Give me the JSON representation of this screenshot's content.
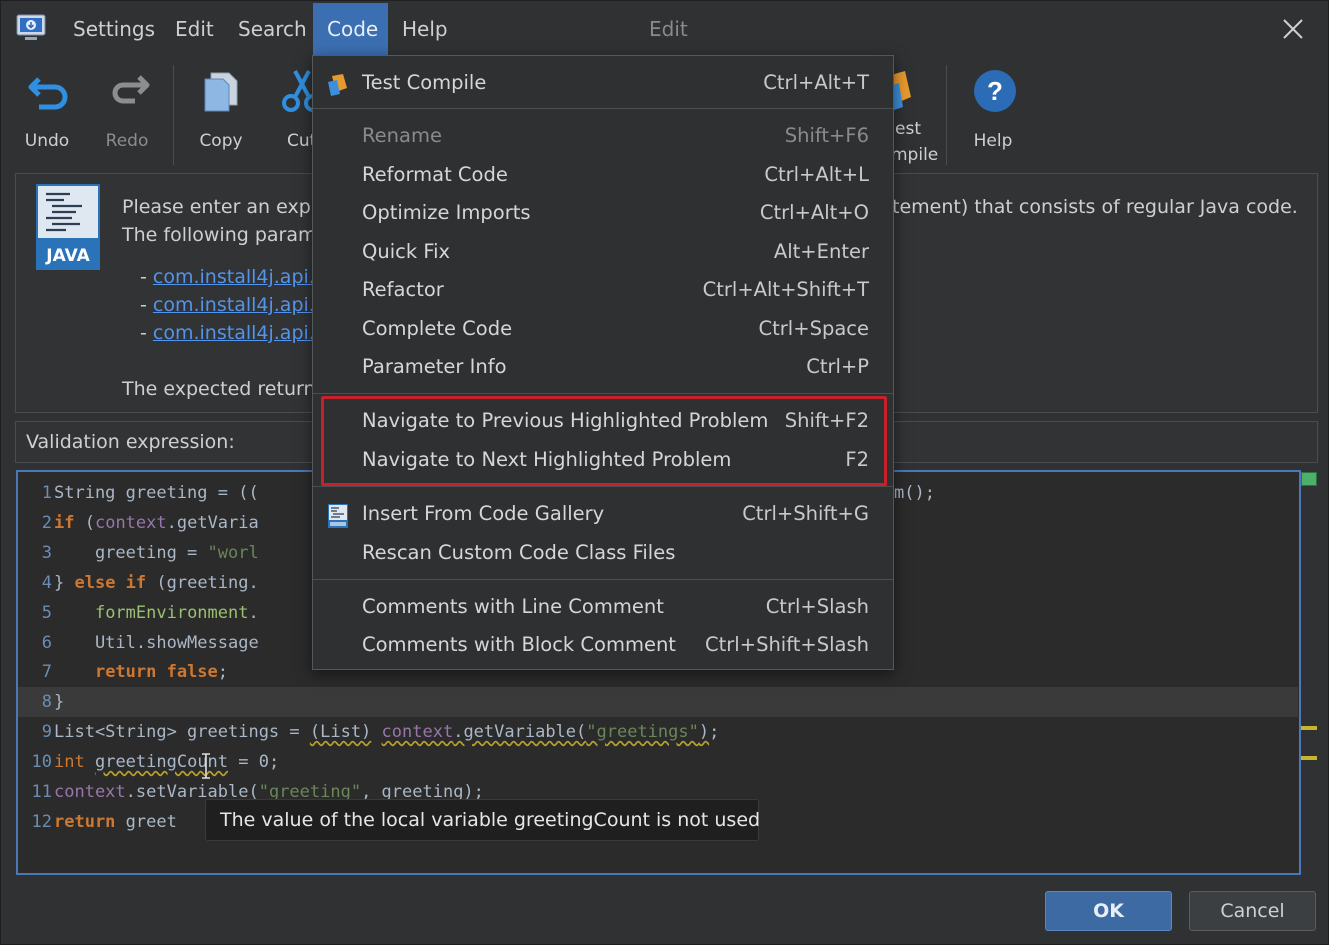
{
  "menubar": {
    "items": [
      "Settings",
      "Edit",
      "Search",
      "Code",
      "Help"
    ],
    "active": "Code",
    "window_title": "Edit"
  },
  "toolbar": {
    "undo": "Undo",
    "redo": "Redo",
    "copy": "Copy",
    "cut_partial": "Cut",
    "test_compile_partial_1": "est",
    "test_compile_partial_2": "mpile",
    "help": "Help"
  },
  "info": {
    "logo_text": "JAVA",
    "line1_left": "Please enter an expr",
    "line1_right": "tement) that consists of regular Java code.",
    "line2_left": "The following param",
    "links": [
      "com.install4j.api.c",
      "com.install4j.api.s",
      "com.install4j.api.f"
    ],
    "link_prefix": "- ",
    "line_return": "The expected return"
  },
  "validation_label": "Validation expression:",
  "editor": {
    "lines": [
      {
        "n": "1",
        "segments": [
          [
            "pl",
            "String greeting = (("
          ]
        ],
        "tail": "m();"
      },
      {
        "n": "2",
        "segments": [
          [
            "kw",
            "if"
          ],
          [
            "pl",
            " ("
          ],
          [
            "fld",
            "context"
          ],
          [
            "pl",
            ".getVaria"
          ]
        ]
      },
      {
        "n": "3",
        "segments": [
          [
            "pl",
            "    greeting = "
          ],
          [
            "str",
            "\"worl"
          ]
        ]
      },
      {
        "n": "4",
        "segments": [
          [
            "pl",
            "} "
          ],
          [
            "kw",
            "else if"
          ],
          [
            "pl",
            " (greeting."
          ]
        ]
      },
      {
        "n": "5",
        "segments": [
          [
            "pl",
            "    "
          ],
          [
            "grn",
            "formEnvironment"
          ],
          [
            "pl",
            "."
          ]
        ]
      },
      {
        "n": "6",
        "segments": [
          [
            "pl",
            "    Util.showMessage"
          ]
        ]
      },
      {
        "n": "7",
        "segments": [
          [
            "pl",
            "    "
          ],
          [
            "kw",
            "return false"
          ],
          [
            "pl",
            ";"
          ]
        ]
      },
      {
        "n": "8",
        "segments": [
          [
            "pl",
            "}"
          ]
        ]
      },
      {
        "n": "9",
        "segments": [
          [
            "pl",
            "List<String> greetings = "
          ],
          [
            "uwp",
            "(List)"
          ],
          [
            "pl",
            " "
          ],
          [
            "uwf",
            "context"
          ],
          [
            "uwp",
            ".getVariable("
          ],
          [
            "uws",
            "\"greetings\""
          ],
          [
            "uwp",
            ")"
          ],
          [
            "pl",
            ";"
          ]
        ]
      },
      {
        "n": "10",
        "segments": [
          [
            "kw2",
            "int"
          ],
          [
            "pl",
            " "
          ],
          [
            "uwp",
            "greetingCount"
          ],
          [
            "pl",
            " = 0;"
          ]
        ]
      },
      {
        "n": "11",
        "segments": [
          [
            "fld",
            "context"
          ],
          [
            "pl",
            ".setVariable("
          ],
          [
            "str",
            "\"greeting\""
          ],
          [
            "pl",
            ", greeting);"
          ]
        ]
      },
      {
        "n": "12",
        "segments": [
          [
            "kw",
            "return"
          ],
          [
            "pl",
            " greet"
          ]
        ]
      }
    ]
  },
  "tooltip": "The value of the local variable greetingCount is not used",
  "buttons": {
    "ok": "OK",
    "cancel": "Cancel"
  },
  "code_menu": {
    "items": [
      {
        "label": "Test Compile",
        "shortcut": "Ctrl+Alt+T",
        "icon": "test-compile-icon"
      },
      {
        "label": "Rename",
        "shortcut": "Shift+F6",
        "disabled": true
      },
      {
        "label": "Reformat Code",
        "shortcut": "Ctrl+Alt+L"
      },
      {
        "label": "Optimize Imports",
        "shortcut": "Ctrl+Alt+O"
      },
      {
        "label": "Quick Fix",
        "shortcut": "Alt+Enter"
      },
      {
        "label": "Refactor",
        "shortcut": "Ctrl+Alt+Shift+T"
      },
      {
        "label": "Complete Code",
        "shortcut": "Ctrl+Space"
      },
      {
        "label": "Parameter Info",
        "shortcut": "Ctrl+P"
      },
      {
        "label": "Navigate to Previous Highlighted Problem",
        "shortcut": "Shift+F2"
      },
      {
        "label": "Navigate to Next Highlighted Problem",
        "shortcut": "F2"
      },
      {
        "label": "Insert From Code Gallery",
        "shortcut": "Ctrl+Shift+G",
        "icon": "code-gallery-icon"
      },
      {
        "label": "Rescan Custom Code Class Files",
        "shortcut": ""
      },
      {
        "label": "Comments with Line Comment",
        "shortcut": "Ctrl+Slash"
      },
      {
        "label": "Comments with Block Comment",
        "shortcut": "Ctrl+Shift+Slash"
      }
    ]
  },
  "colors": {
    "accent": "#3b6fb1",
    "highlight_border": "#c8212b",
    "keyword": "#cc7832",
    "string": "#6a8759"
  }
}
